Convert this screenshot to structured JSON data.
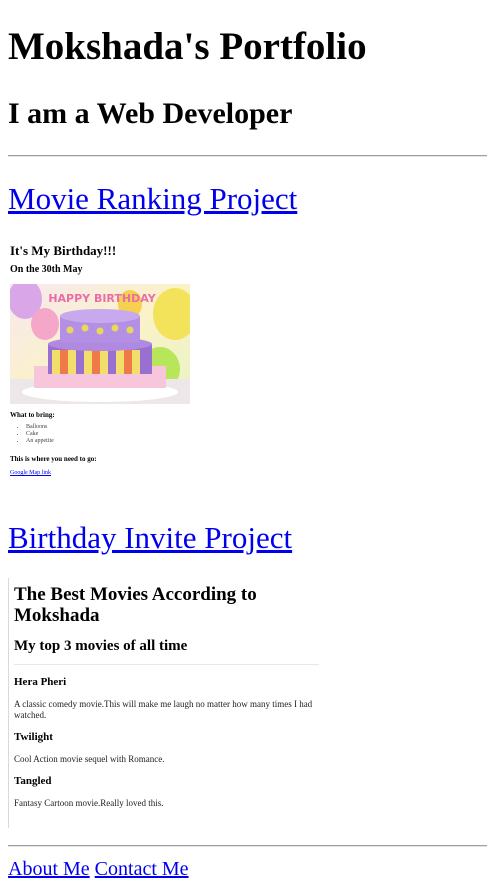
{
  "header": {
    "title": "Mokshada's Portfolio",
    "subtitle": "I am a Web Developer"
  },
  "projects": [
    {
      "label": "Movie Ranking Project"
    },
    {
      "label": "Birthday Invite Project"
    }
  ],
  "birthday_preview": {
    "heading": "It's My Birthday!!!",
    "date": "On the 30th May",
    "image_text": "HAPPY BIRTHDAY",
    "bring_label": "What to bring:",
    "items": [
      "Balloons",
      "Cake",
      "An appetite"
    ],
    "where_label": "This is where you need to go:",
    "map_link": "Google Map link"
  },
  "movies_preview": {
    "heading": "The Best Movies According to Mokshada",
    "subheading": "My top 3 movies of all time",
    "movies": [
      {
        "title": "Hera Pheri",
        "desc": "A classic comedy movie.This will make me laugh no matter how many times I had watched."
      },
      {
        "title": "Twilight",
        "desc": "Cool Action movie sequel with Romance."
      },
      {
        "title": "Tangled",
        "desc": "Fantasy Cartoon movie.Really loved this."
      }
    ]
  },
  "footer": {
    "about": "About Me",
    "contact": "Contact Me"
  }
}
